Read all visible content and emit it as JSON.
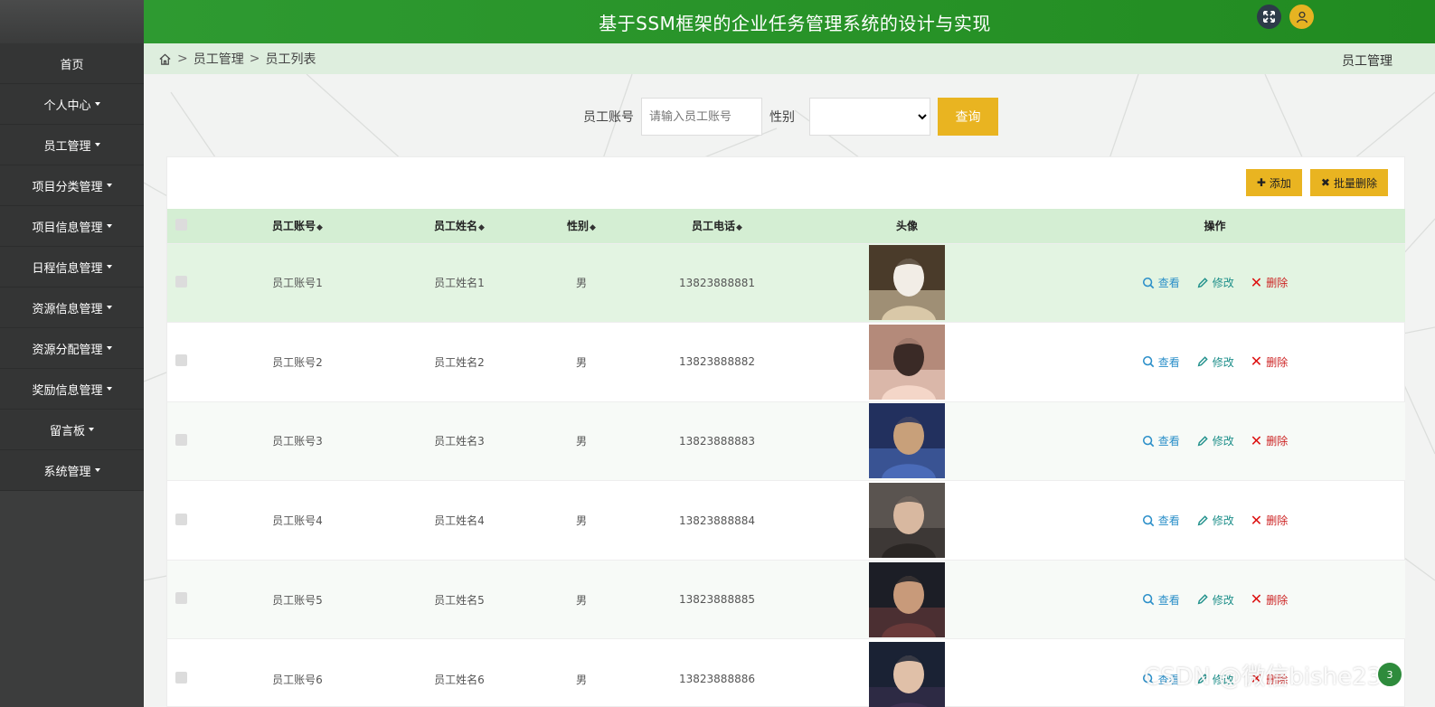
{
  "header": {
    "title": "基于SSM框架的企业任务管理系统的设计与实现"
  },
  "icons": {
    "fullscreen": "expand-icon",
    "user": "user-icon",
    "home": "home-icon"
  },
  "sidebar": {
    "items": [
      {
        "label": "首页",
        "dropdown": false
      },
      {
        "label": "个人中心",
        "dropdown": true
      },
      {
        "label": "员工管理",
        "dropdown": true
      },
      {
        "label": "项目分类管理",
        "dropdown": true
      },
      {
        "label": "项目信息管理",
        "dropdown": true
      },
      {
        "label": "日程信息管理",
        "dropdown": true
      },
      {
        "label": "资源信息管理",
        "dropdown": true
      },
      {
        "label": "资源分配管理",
        "dropdown": true
      },
      {
        "label": "奖励信息管理",
        "dropdown": true
      },
      {
        "label": "留言板",
        "dropdown": true
      },
      {
        "label": "系统管理",
        "dropdown": true
      }
    ]
  },
  "breadcrumb": {
    "sep": ">",
    "level1": "员工管理",
    "level2": "员工列表",
    "right": "员工管理"
  },
  "search": {
    "account_label": "员工账号",
    "account_placeholder": "请输入员工账号",
    "account_value": "",
    "gender_label": "性别",
    "gender_value": "",
    "query_label": "查询"
  },
  "toolbar": {
    "add_label": "添加",
    "batch_delete_label": "批量删除"
  },
  "table": {
    "headers": [
      "员工账号",
      "员工姓名",
      "性别",
      "员工电话",
      "头像",
      "操作"
    ],
    "rows": [
      {
        "account": "员工账号1",
        "name": "员工姓名1",
        "gender": "男",
        "phone": "13823888881"
      },
      {
        "account": "员工账号2",
        "name": "员工姓名2",
        "gender": "男",
        "phone": "13823888882"
      },
      {
        "account": "员工账号3",
        "name": "员工姓名3",
        "gender": "男",
        "phone": "13823888883"
      },
      {
        "account": "员工账号4",
        "name": "员工姓名4",
        "gender": "男",
        "phone": "13823888884"
      },
      {
        "account": "员工账号5",
        "name": "员工姓名5",
        "gender": "男",
        "phone": "13823888885"
      },
      {
        "account": "员工账号6",
        "name": "员工姓名6",
        "gender": "男",
        "phone": "13823888886"
      }
    ],
    "actions": {
      "view": "查看",
      "edit": "修改",
      "delete": "删除"
    }
  },
  "watermark": "CSDN @微信bishe234",
  "badge": "3",
  "colors": {
    "header_green": "#279227",
    "accent_yellow": "#e9b421",
    "sidebar_dark": "#3c3d3d",
    "table_header": "#d4eed3"
  }
}
